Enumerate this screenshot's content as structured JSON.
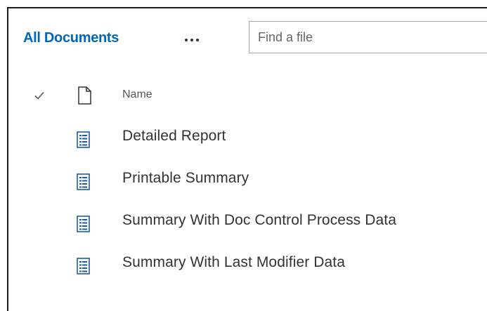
{
  "toolbar": {
    "view_title": "All Documents",
    "more_label": "...",
    "search_placeholder": "Find a file",
    "search_value": ""
  },
  "list": {
    "header": {
      "name_label": "Name"
    },
    "items": [
      {
        "name": "Detailed Report",
        "icon": "list-page-icon"
      },
      {
        "name": "Printable Summary",
        "icon": "list-page-icon"
      },
      {
        "name": "Summary With Doc Control Process Data",
        "icon": "list-page-icon"
      },
      {
        "name": "Summary With Last Modifier Data",
        "icon": "list-page-icon"
      }
    ]
  },
  "colors": {
    "accent": "#0078d4",
    "text": "#333333",
    "icon_blue": "#1e5aa8",
    "border": "#a6a6a6"
  }
}
